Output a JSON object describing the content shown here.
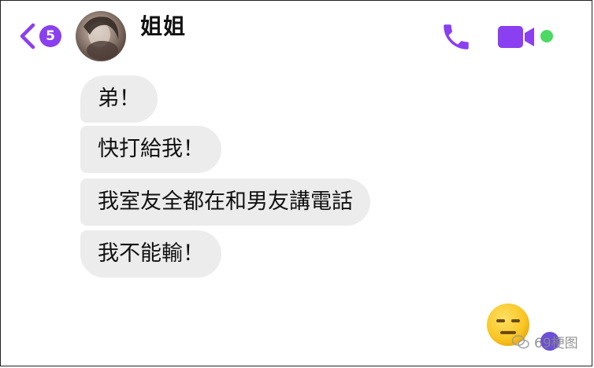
{
  "header": {
    "back_count": "5",
    "contact_name": "姐姐",
    "icons": [
      "back-chevron-icon",
      "phone-icon",
      "video-camera-icon"
    ],
    "online": true
  },
  "messages": [
    {
      "text": "弟！"
    },
    {
      "text": "快打給我！"
    },
    {
      "text": "我室友全都在和男友講電話"
    },
    {
      "text": "我不能輸！"
    }
  ],
  "reaction_emoji": "expressionless-face",
  "watermark": "69梗图",
  "colors": {
    "accent": "#8a3ff0",
    "bubble": "#ececec",
    "online": "#4cd964"
  }
}
